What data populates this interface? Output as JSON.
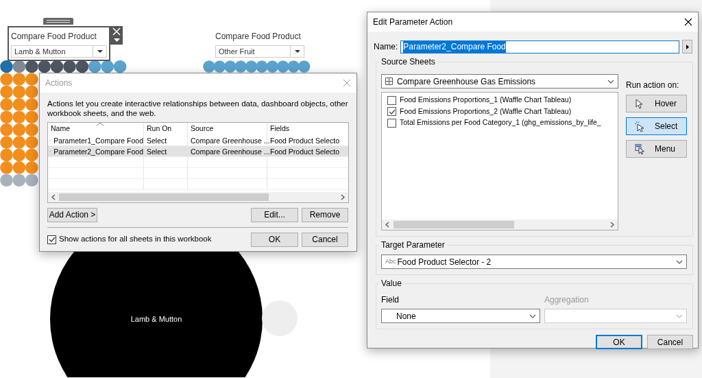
{
  "dashboard": {
    "filters": [
      {
        "title": "Compare Food Product",
        "value": "Lamb & Mutton",
        "selected": true
      },
      {
        "title": "Compare Food Product",
        "value": "Other Fruit",
        "selected": false
      }
    ],
    "bubble_label": "Lamb & Mutton"
  },
  "actions_dialog": {
    "title": "Actions",
    "active": false,
    "description": "Actions let you create interactive relationships between data, dashboard objects, other workbook sheets, and the web.",
    "columns": [
      "Name",
      "Run On",
      "Source",
      "Fields"
    ],
    "rows": [
      {
        "name": "Parameter1_Compare Food",
        "run_on": "Select",
        "source": "Compare Greenhouse ...",
        "fields": "Food Product Selecto",
        "selected": false
      },
      {
        "name": "Parameter2_Compare Food",
        "run_on": "Select",
        "source": "Compare Greenhouse ...",
        "fields": "Food Product Selecto",
        "selected": true
      }
    ],
    "add_button": "Add Action >",
    "edit_button": "Edit...",
    "remove_button": "Remove",
    "show_all": {
      "label": "Show actions for all sheets in this workbook",
      "checked": true
    },
    "ok_button": "OK",
    "cancel_button": "Cancel"
  },
  "edit_dialog": {
    "title": "Edit Parameter Action",
    "active": true,
    "name_label": "Name:",
    "name_value": "Parameter2_Compare Food",
    "source_sheets": {
      "legend": "Source Sheets",
      "dashboard": "Compare Greenhouse Gas Emissions",
      "sheets": [
        {
          "label": "Food Emissions Proportions_1 (Waffle Chart Tableau)",
          "checked": false
        },
        {
          "label": "Food Emissions Proportions_2 (Waffle Chart Tableau)",
          "checked": true
        },
        {
          "label": "Total Emissions per Food Category_1 (ghg_emissions_by_life_",
          "checked": false
        }
      ],
      "run_on_label": "Run action on:",
      "run_on": [
        {
          "label": "Hover",
          "kind": "hover",
          "selected": false
        },
        {
          "label": "Select",
          "kind": "select",
          "selected": true
        },
        {
          "label": "Menu",
          "kind": "menu",
          "selected": false
        }
      ]
    },
    "target": {
      "legend": "Target Parameter",
      "type_label": "Abc",
      "value": "Food Product Selector - 2"
    },
    "value": {
      "legend": "Value",
      "field_label": "Field",
      "field_value": "None",
      "aggregation_label": "Aggregation",
      "aggregation_disabled": true
    },
    "ok_button": "OK",
    "cancel_button": "Cancel"
  }
}
